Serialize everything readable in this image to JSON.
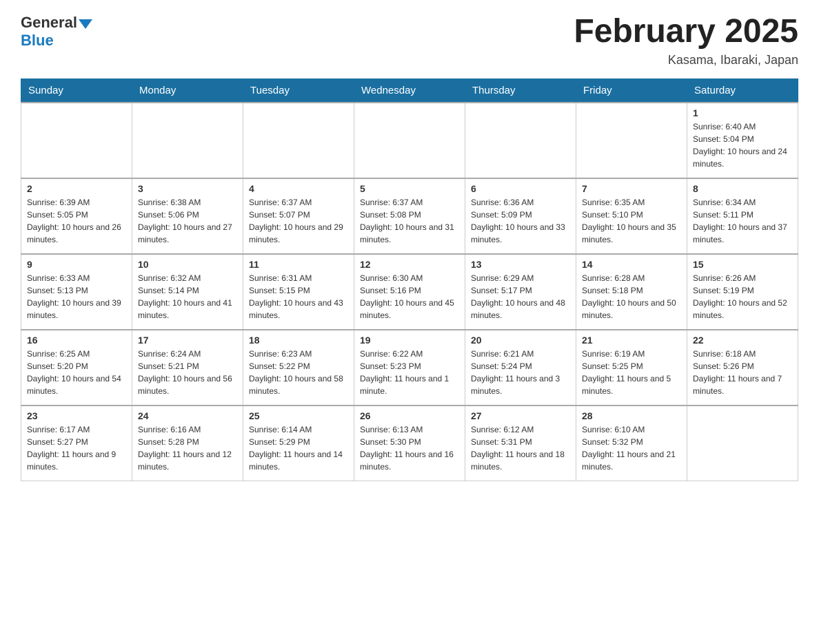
{
  "header": {
    "logo_general": "General",
    "logo_blue": "Blue",
    "month_title": "February 2025",
    "location": "Kasama, Ibaraki, Japan"
  },
  "weekdays": [
    "Sunday",
    "Monday",
    "Tuesday",
    "Wednesday",
    "Thursday",
    "Friday",
    "Saturday"
  ],
  "weeks": [
    [
      {
        "day": "",
        "info": ""
      },
      {
        "day": "",
        "info": ""
      },
      {
        "day": "",
        "info": ""
      },
      {
        "day": "",
        "info": ""
      },
      {
        "day": "",
        "info": ""
      },
      {
        "day": "",
        "info": ""
      },
      {
        "day": "1",
        "info": "Sunrise: 6:40 AM\nSunset: 5:04 PM\nDaylight: 10 hours and 24 minutes."
      }
    ],
    [
      {
        "day": "2",
        "info": "Sunrise: 6:39 AM\nSunset: 5:05 PM\nDaylight: 10 hours and 26 minutes."
      },
      {
        "day": "3",
        "info": "Sunrise: 6:38 AM\nSunset: 5:06 PM\nDaylight: 10 hours and 27 minutes."
      },
      {
        "day": "4",
        "info": "Sunrise: 6:37 AM\nSunset: 5:07 PM\nDaylight: 10 hours and 29 minutes."
      },
      {
        "day": "5",
        "info": "Sunrise: 6:37 AM\nSunset: 5:08 PM\nDaylight: 10 hours and 31 minutes."
      },
      {
        "day": "6",
        "info": "Sunrise: 6:36 AM\nSunset: 5:09 PM\nDaylight: 10 hours and 33 minutes."
      },
      {
        "day": "7",
        "info": "Sunrise: 6:35 AM\nSunset: 5:10 PM\nDaylight: 10 hours and 35 minutes."
      },
      {
        "day": "8",
        "info": "Sunrise: 6:34 AM\nSunset: 5:11 PM\nDaylight: 10 hours and 37 minutes."
      }
    ],
    [
      {
        "day": "9",
        "info": "Sunrise: 6:33 AM\nSunset: 5:13 PM\nDaylight: 10 hours and 39 minutes."
      },
      {
        "day": "10",
        "info": "Sunrise: 6:32 AM\nSunset: 5:14 PM\nDaylight: 10 hours and 41 minutes."
      },
      {
        "day": "11",
        "info": "Sunrise: 6:31 AM\nSunset: 5:15 PM\nDaylight: 10 hours and 43 minutes."
      },
      {
        "day": "12",
        "info": "Sunrise: 6:30 AM\nSunset: 5:16 PM\nDaylight: 10 hours and 45 minutes."
      },
      {
        "day": "13",
        "info": "Sunrise: 6:29 AM\nSunset: 5:17 PM\nDaylight: 10 hours and 48 minutes."
      },
      {
        "day": "14",
        "info": "Sunrise: 6:28 AM\nSunset: 5:18 PM\nDaylight: 10 hours and 50 minutes."
      },
      {
        "day": "15",
        "info": "Sunrise: 6:26 AM\nSunset: 5:19 PM\nDaylight: 10 hours and 52 minutes."
      }
    ],
    [
      {
        "day": "16",
        "info": "Sunrise: 6:25 AM\nSunset: 5:20 PM\nDaylight: 10 hours and 54 minutes."
      },
      {
        "day": "17",
        "info": "Sunrise: 6:24 AM\nSunset: 5:21 PM\nDaylight: 10 hours and 56 minutes."
      },
      {
        "day": "18",
        "info": "Sunrise: 6:23 AM\nSunset: 5:22 PM\nDaylight: 10 hours and 58 minutes."
      },
      {
        "day": "19",
        "info": "Sunrise: 6:22 AM\nSunset: 5:23 PM\nDaylight: 11 hours and 1 minute."
      },
      {
        "day": "20",
        "info": "Sunrise: 6:21 AM\nSunset: 5:24 PM\nDaylight: 11 hours and 3 minutes."
      },
      {
        "day": "21",
        "info": "Sunrise: 6:19 AM\nSunset: 5:25 PM\nDaylight: 11 hours and 5 minutes."
      },
      {
        "day": "22",
        "info": "Sunrise: 6:18 AM\nSunset: 5:26 PM\nDaylight: 11 hours and 7 minutes."
      }
    ],
    [
      {
        "day": "23",
        "info": "Sunrise: 6:17 AM\nSunset: 5:27 PM\nDaylight: 11 hours and 9 minutes."
      },
      {
        "day": "24",
        "info": "Sunrise: 6:16 AM\nSunset: 5:28 PM\nDaylight: 11 hours and 12 minutes."
      },
      {
        "day": "25",
        "info": "Sunrise: 6:14 AM\nSunset: 5:29 PM\nDaylight: 11 hours and 14 minutes."
      },
      {
        "day": "26",
        "info": "Sunrise: 6:13 AM\nSunset: 5:30 PM\nDaylight: 11 hours and 16 minutes."
      },
      {
        "day": "27",
        "info": "Sunrise: 6:12 AM\nSunset: 5:31 PM\nDaylight: 11 hours and 18 minutes."
      },
      {
        "day": "28",
        "info": "Sunrise: 6:10 AM\nSunset: 5:32 PM\nDaylight: 11 hours and 21 minutes."
      },
      {
        "day": "",
        "info": ""
      }
    ]
  ]
}
